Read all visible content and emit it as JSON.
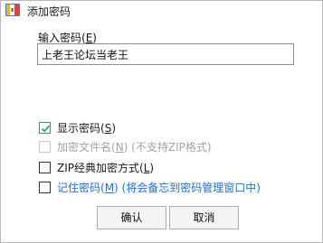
{
  "window": {
    "title": "添加密码"
  },
  "password": {
    "label_main": "输入密码(",
    "label_key": "E",
    "label_end": ")",
    "value": "上老王论坛当老王"
  },
  "options": {
    "show_password": {
      "text_main": "显示密码(",
      "key": "S",
      "text_end": ")",
      "checked": true,
      "enabled": true
    },
    "encrypt_filenames": {
      "text_main": "加密文件名(",
      "key": "N",
      "text_end": ") (不支持ZIP格式)",
      "checked": false,
      "enabled": false
    },
    "zip_classic": {
      "text_main": "ZIP经典加密方式(",
      "key": "L",
      "text_end": ")",
      "checked": false,
      "enabled": true
    },
    "remember_password": {
      "text_main": "记住密码(",
      "key": "M",
      "text_end": ") (将会备忘到密码管理窗口中)",
      "checked": false,
      "enabled": true
    }
  },
  "buttons": {
    "ok": "确认",
    "cancel": "取消"
  },
  "colors": {
    "check_green": "#2a9d62",
    "link_blue": "#1c6fd6",
    "disabled_gray": "#a3a3a3"
  }
}
